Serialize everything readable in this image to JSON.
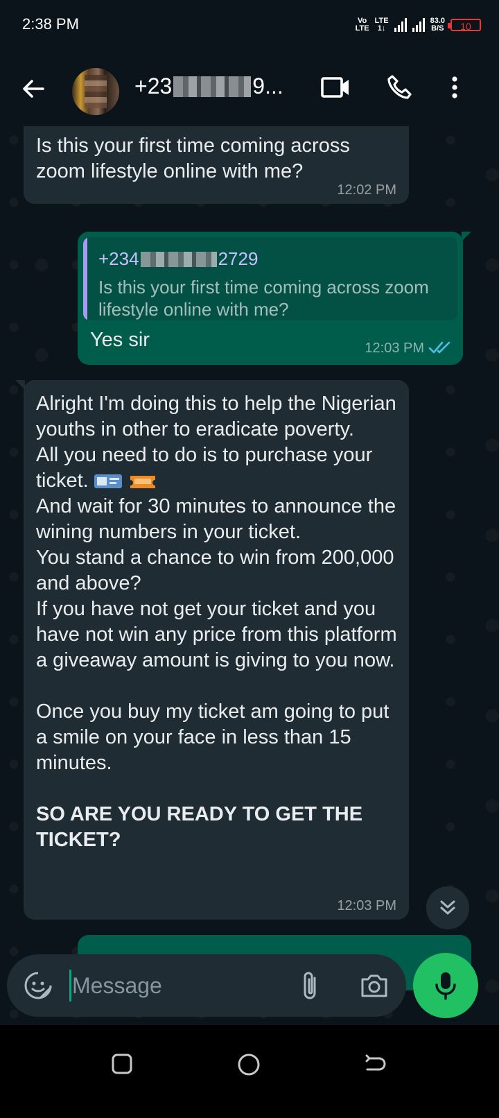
{
  "status_bar": {
    "time": "2:38 PM",
    "volte_top": "Vo",
    "volte_bottom": "LTE",
    "lte_top": "LTE",
    "lte_bottom": "1↓",
    "speed_value": "83.0",
    "speed_unit": "B/S",
    "battery": "10"
  },
  "header": {
    "contact_prefix": "+23",
    "contact_suffix": "9..."
  },
  "messages": [
    {
      "direction": "in",
      "text": "Is this your first time coming across zoom lifestyle online with me?",
      "time": "12:02 PM"
    },
    {
      "direction": "out",
      "quote_name_prefix": "+234",
      "quote_name_suffix": "2729",
      "quote_text": "Is this your first time coming across zoom lifestyle online with me?",
      "text": "Yes sir",
      "time": "12:03 PM"
    },
    {
      "direction": "in",
      "p1": "Alright I'm doing this to help the Nigerian youths in other to eradicate poverty.",
      "p2": "All you need to do is to purchase your ticket.",
      "p3": "And wait for 30 minutes to announce the wining numbers in your ticket.",
      "p4": "You stand a chance to win from 200,000 and above?",
      "p5": "If you have not get your ticket and you have not win any price from this platform a giveaway amount is giving to you now.",
      "p6": "Once you buy my ticket am going to put a smile on your face in less than 15 minutes.",
      "p7": "SO ARE YOU READY TO GET THE TICKET?",
      "time": "12:03 PM"
    }
  ],
  "composer": {
    "placeholder": "Message"
  },
  "colors": {
    "background": "#0b141a",
    "incoming_bubble": "#202c33",
    "outgoing_bubble": "#005c4b",
    "accent": "#21c063",
    "read_ticks": "#53bdeb"
  }
}
